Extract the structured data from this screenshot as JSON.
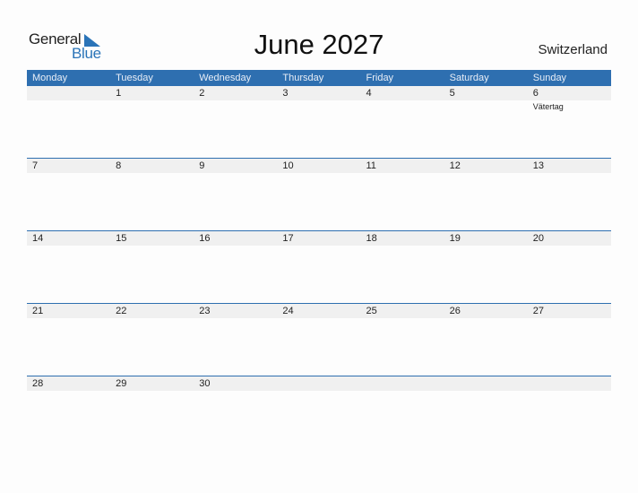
{
  "logo": {
    "line1": "General",
    "line2": "Blue"
  },
  "title": "June 2027",
  "country": "Switzerland",
  "colors": {
    "accent": "#2e6fb0",
    "row_bg": "#f0f0f0"
  },
  "weekdays": [
    "Monday",
    "Tuesday",
    "Wednesday",
    "Thursday",
    "Friday",
    "Saturday",
    "Sunday"
  ],
  "weeks": [
    {
      "days": [
        "",
        "1",
        "2",
        "3",
        "4",
        "5",
        "6"
      ],
      "holidays": [
        "",
        "",
        "",
        "",
        "",
        "",
        "Vätertag"
      ]
    },
    {
      "days": [
        "7",
        "8",
        "9",
        "10",
        "11",
        "12",
        "13"
      ],
      "holidays": [
        "",
        "",
        "",
        "",
        "",
        "",
        ""
      ]
    },
    {
      "days": [
        "14",
        "15",
        "16",
        "17",
        "18",
        "19",
        "20"
      ],
      "holidays": [
        "",
        "",
        "",
        "",
        "",
        "",
        ""
      ]
    },
    {
      "days": [
        "21",
        "22",
        "23",
        "24",
        "25",
        "26",
        "27"
      ],
      "holidays": [
        "",
        "",
        "",
        "",
        "",
        "",
        ""
      ]
    },
    {
      "days": [
        "28",
        "29",
        "30",
        "",
        "",
        "",
        ""
      ],
      "holidays": [
        "",
        "",
        "",
        "",
        "",
        "",
        ""
      ]
    }
  ]
}
